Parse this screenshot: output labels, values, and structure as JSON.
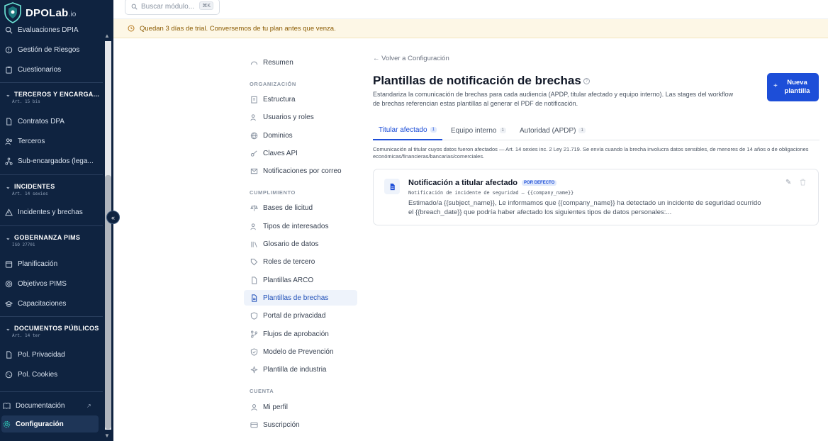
{
  "app": {
    "logo_text": "DPOLab",
    "logo_suffix": ".io",
    "colors": {
      "sidebar_bg": "#0f2340",
      "accent": "#1d4ed8",
      "trial_bg": "#fdf7e6"
    }
  },
  "topbar": {
    "search_placeholder": "Buscar módulo...",
    "search_shortcut": "⌘K"
  },
  "trial_banner": {
    "text": "Quedan 3 días de trial. Conversemos de tu plan antes que venza."
  },
  "sidebar": {
    "items": [
      {
        "label": "Evaluaciones DPIA",
        "icon": "search-icon"
      },
      {
        "label": "Gestión de Riesgos",
        "icon": "shield-alert-icon"
      },
      {
        "label": "Cuestionarios",
        "icon": "clipboard-icon"
      },
      {
        "label": "Contratos DPA",
        "icon": "document-icon"
      },
      {
        "label": "Terceros",
        "icon": "users-icon"
      },
      {
        "label": "Sub-encargados (lega...",
        "icon": "network-icon"
      },
      {
        "label": "Incidentes y brechas",
        "icon": "warning-icon"
      },
      {
        "label": "Planificación",
        "icon": "calendar-icon"
      },
      {
        "label": "Objetivos PIMS",
        "icon": "target-icon"
      },
      {
        "label": "Capacitaciones",
        "icon": "graduation-icon"
      },
      {
        "label": "Pol. Privacidad",
        "icon": "document-icon"
      },
      {
        "label": "Pol. Cookies",
        "icon": "cookie-icon"
      },
      {
        "label": "Documentación",
        "icon": "book-icon"
      },
      {
        "label": "Configuración",
        "icon": "gear-icon"
      }
    ],
    "sections": [
      {
        "title": "TERCEROS Y ENCARGA...",
        "sub": "Art. 15 bis"
      },
      {
        "title": "INCIDENTES",
        "sub": "Art. 14 sexies"
      },
      {
        "title": "GOBERNANZA PIMS",
        "sub": "ISO 27701"
      },
      {
        "title": "DOCUMENTOS PÚBLICOS",
        "sub": "Art. 14 ter"
      }
    ]
  },
  "settings_nav": {
    "items": [
      {
        "label": "Resumen"
      },
      {
        "label": "Estructura"
      },
      {
        "label": "Usuarios y roles"
      },
      {
        "label": "Dominios"
      },
      {
        "label": "Claves API"
      },
      {
        "label": "Notificaciones por correo"
      },
      {
        "label": "Bases de licitud"
      },
      {
        "label": "Tipos de interesados"
      },
      {
        "label": "Glosario de datos"
      },
      {
        "label": "Roles de tercero"
      },
      {
        "label": "Plantillas ARCO"
      },
      {
        "label": "Plantillas de brechas"
      },
      {
        "label": "Portal de privacidad"
      },
      {
        "label": "Flujos de aprobación"
      },
      {
        "label": "Modelo de Prevención"
      },
      {
        "label": "Plantilla de industria"
      },
      {
        "label": "Mi perfil"
      },
      {
        "label": "Suscripción"
      }
    ],
    "headings": [
      "ORGANIZACIÓN",
      "CUMPLIMIENTO",
      "CUENTA"
    ]
  },
  "main": {
    "back_link": "Volver a Configuración",
    "title": "Plantillas de notificación de brechas",
    "description": "Estandariza la comunicación de brechas para cada audiencia (APDP, titular afectado y equipo interno). Las stages del workflow de brechas referencian estas plantillas al generar el PDF de notificación.",
    "new_button": "Nueva plantilla",
    "tabs": [
      {
        "label": "Titular afectado",
        "count": "1"
      },
      {
        "label": "Equipo interno",
        "count": "1"
      },
      {
        "label": "Autoridad (APDP)",
        "count": "1"
      }
    ],
    "tab_note": "Comunicación al titular cuyos datos fueron afectados — Art. 14 sexies inc. 2 Ley 21.719. Se envía cuando la brecha involucra datos sensibles, de menores de 14 años o de obligaciones económicas/financieras/bancarias/comerciales.",
    "template_card": {
      "title": "Notificación a titular afectado",
      "badge": "POR DEFECTO",
      "subject": "Notificación de incidente de seguridad — {{company_name}}",
      "body": "Estimado/a {{subject_name}}, Le informamos que {{company_name}} ha detectado un incidente de seguridad ocurrido el {{breach_date}} que podría haber afectado los siguientes tipos de datos personales:..."
    }
  }
}
